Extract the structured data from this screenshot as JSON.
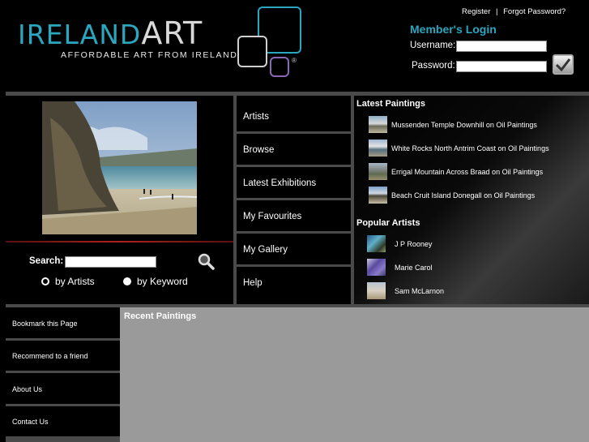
{
  "logo": {
    "word_ireland": "IRELAND",
    "word_art": "ART",
    "tagline": "AFFORDABLE ART FROM IRELAND",
    "reg": "®"
  },
  "toplinks": {
    "register": "Register",
    "separator": "|",
    "forgot": "Forgot Password?"
  },
  "login": {
    "title": "Member's Login",
    "username_label": "Username:",
    "password_label": "Password:",
    "username_value": "",
    "password_value": ""
  },
  "search": {
    "label": "Search:",
    "value": "",
    "by_artists": "by Artists",
    "by_keyword": "by Keyword",
    "selected": "by Keyword"
  },
  "nav": [
    "Artists",
    "Browse",
    "Latest Exhibitions",
    "My Favourites",
    "My Gallery",
    "Help"
  ],
  "latest": {
    "title": "Latest Paintings",
    "items": [
      "Mussenden Temple Downhill on Oil Paintings",
      "White Rocks North Antrim Coast on Oil Paintings",
      "Errigal Mountain Across Braad on Oil Paintings",
      "Beach Cruit Island Donegall on Oil Paintings"
    ]
  },
  "popular": {
    "title": "Popular Artists",
    "items": [
      "J P Rooney",
      "Marie Carol",
      "Sam McLarnon"
    ]
  },
  "bottom_links": [
    "Bookmark this Page",
    "Recommend to a friend",
    "About Us",
    "Contact Us"
  ],
  "recent": {
    "title": "Recent Paintings"
  },
  "colors": {
    "accent": "#2aa6bf",
    "panel_grey": "#9a9a9a",
    "divider": "#4a4a4a"
  }
}
